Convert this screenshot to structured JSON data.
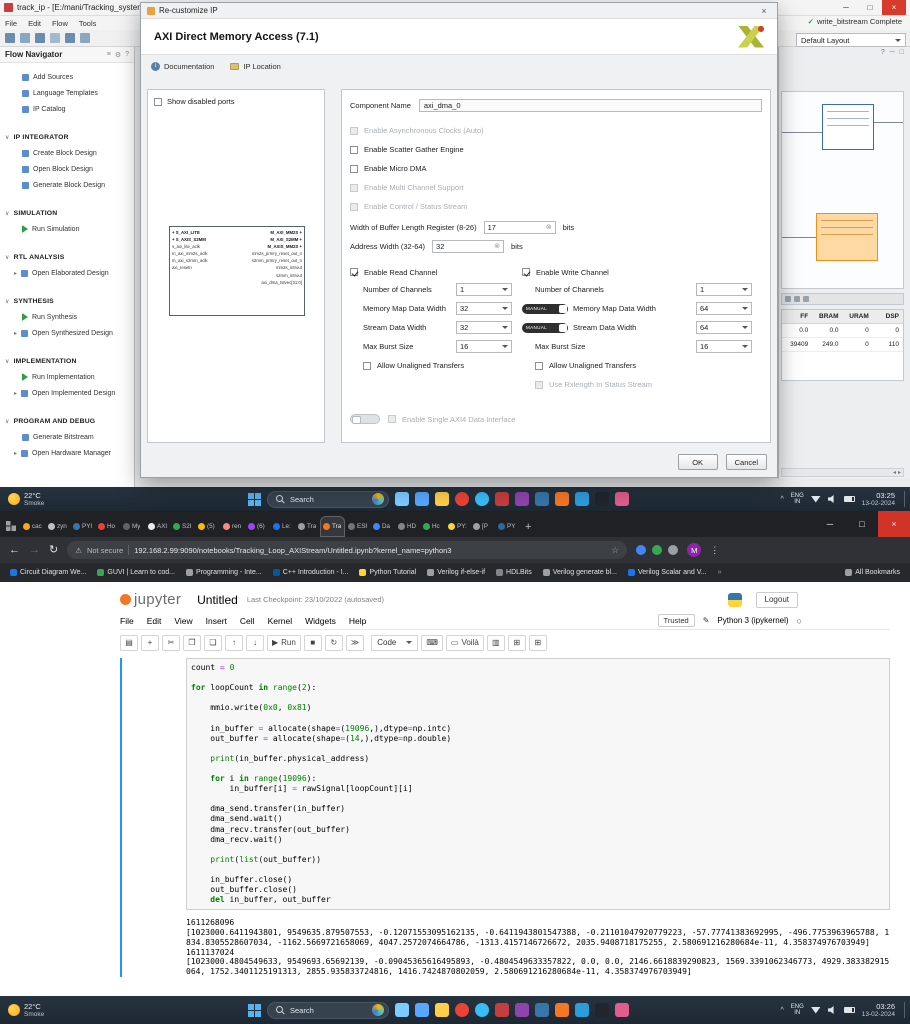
{
  "glyphs": {
    "min": "─",
    "max": "□",
    "close": "×",
    "chevron_down": "∨",
    "tri_right": "▸",
    "check": "✓",
    "reset": "⊗",
    "caret_up": "^",
    "back": "←",
    "forward": "→",
    "reload": "↻",
    "star": "☆",
    "menu_dots": "⋮",
    "plus": "+",
    "chevrons_right": "»",
    "question": "?",
    "info_i": "i",
    "kernel_circle": "○",
    "pencil": "✎",
    "warn": "!"
  },
  "vivado": {
    "titlebar": {
      "title": "track_ip - [E:/mani/Tracking_system_fo"
    },
    "menus": [
      "File",
      "Edit",
      "Flow",
      "Tools"
    ],
    "status_complete": "write_bitstream Complete",
    "layout_dropdown": "Default Layout",
    "flow_navigator": {
      "title": "Flow Navigator",
      "top_items": [
        {
          "label": "Add Sources"
        },
        {
          "label": "Language Templates"
        },
        {
          "label": "IP Catalog"
        }
      ],
      "sections": [
        {
          "label": "IP INTEGRATOR",
          "items": [
            {
              "label": "Create Block Design"
            },
            {
              "label": "Open Block Design"
            },
            {
              "label": "Generate Block Design"
            }
          ]
        },
        {
          "label": "SIMULATION",
          "items": [
            {
              "label": "Run Simulation",
              "run": true
            }
          ]
        },
        {
          "label": "RTL ANALYSIS",
          "items": [
            {
              "label": "Open Elaborated Design",
              "exp": true
            }
          ]
        },
        {
          "label": "SYNTHESIS",
          "items": [
            {
              "label": "Run Synthesis",
              "run": true
            },
            {
              "label": "Open Synthesized Design",
              "exp": true
            }
          ]
        },
        {
          "label": "IMPLEMENTATION",
          "items": [
            {
              "label": "Run Implementation",
              "run": true
            },
            {
              "label": "Open Implemented Design",
              "exp": true
            }
          ]
        },
        {
          "label": "PROGRAM AND DEBUG",
          "items": [
            {
              "label": "Generate Bitstream"
            },
            {
              "label": "Open Hardware Manager",
              "exp": true
            }
          ]
        }
      ]
    },
    "right_table": {
      "headers": [
        "FF",
        "BRAM",
        "URAM",
        "DSP"
      ],
      "rows": [
        [
          "0.0",
          "0.0",
          "0",
          "0"
        ],
        [
          "39409",
          "249.0",
          "0",
          "110"
        ]
      ]
    }
  },
  "dialog": {
    "title": "Re-customize IP",
    "heading": "AXI Direct Memory Access (7.1)",
    "doc_tab": "Documentation",
    "location_tab": "IP Location",
    "show_disabled_ports": "Show disabled ports",
    "block": {
      "left_interfaces": [
        "S_AXI_LITE",
        "S_AXIS_S2MM"
      ],
      "left_pins": [
        "s_axi_lite_aclk",
        "m_axi_mm2s_aclk",
        "m_axi_s2mm_aclk",
        "axi_resetn"
      ],
      "right_interfaces": [
        "M_AXI_MM2S",
        "M_AXI_S2MM",
        "M_AXIS_MM2S"
      ],
      "right_pins": [
        "mm2s_prmry_reset_out_n",
        "s2mm_prmry_reset_out_n",
        "mm2s_introut",
        "s2mm_introut",
        "axi_dma_tstvec[31:0]"
      ]
    },
    "component_name_label": "Component Name",
    "component_name_value": "axi_dma_0",
    "options": [
      {
        "label": "Enable Asynchronous Clocks (Auto)",
        "checked": false,
        "disabled": true
      },
      {
        "label": "Enable Scatter Gather Engine",
        "checked": false,
        "disabled": false
      },
      {
        "label": "Enable Micro DMA",
        "checked": false,
        "disabled": false
      },
      {
        "label": "Enable Multi Channel Support",
        "checked": false,
        "disabled": true
      },
      {
        "label": "Enable Control / Status Stream",
        "checked": false,
        "disabled": true
      }
    ],
    "buffer_length": {
      "label": "Width of Buffer Length Register (8-26)",
      "value": "17",
      "unit": "bits"
    },
    "address_width": {
      "label": "Address Width (32-64)",
      "value": "32",
      "unit": "bits"
    },
    "read_channel": {
      "title": "Enable Read Channel",
      "rows": [
        {
          "label": "Number of Channels",
          "value": "1",
          "manual": false
        },
        {
          "label": "Memory Map Data Width",
          "value": "32",
          "manual": false
        },
        {
          "label": "Stream Data Width",
          "value": "32",
          "manual": false
        },
        {
          "label": "Max Burst Size",
          "value": "16",
          "manual": false
        }
      ],
      "allow_unaligned": "Allow Unaligned Transfers"
    },
    "write_channel": {
      "title": "Enable Write Channel",
      "rows": [
        {
          "label": "Number of Channels",
          "value": "1",
          "manual": false
        },
        {
          "label": "Memory Map Data Width",
          "value": "64",
          "manual": true
        },
        {
          "label": "Stream Data Width",
          "value": "64",
          "manual": true
        },
        {
          "label": "Max Burst Size",
          "value": "16",
          "manual": false
        }
      ],
      "allow_unaligned": "Allow Unaligned Transfers",
      "use_rxlength": "Use Rxlength In Status Stream"
    },
    "manual_label": "MANUAL",
    "single_axi4": "Enable Single AXI4 Data Interface",
    "ok": "OK",
    "cancel": "Cancel"
  },
  "taskbar": {
    "temp": "22°C",
    "desc": "Smoke",
    "search": "Search",
    "lang1": "ENG",
    "lang2": "IN",
    "time_top": "03:25",
    "time_bottom": "03:26",
    "date": "13-02-2024",
    "apps": [
      {
        "name": "task-view-icon",
        "color": "#7ecbff"
      },
      {
        "name": "widgets-icon",
        "color": "#58a6ff"
      },
      {
        "name": "file-explorer-icon",
        "color": "#ffcf4a"
      },
      {
        "name": "chrome-icon",
        "color": "#ea4335",
        "round": true
      },
      {
        "name": "edge-icon",
        "color": "#38bdf8",
        "round": true
      },
      {
        "name": "vivado-icon",
        "color": "#c43e3e"
      },
      {
        "name": "vitis-icon",
        "color": "#8e44ad"
      },
      {
        "name": "python-icon",
        "color": "#3776ab"
      },
      {
        "name": "jupyter-icon",
        "color": "#f37726"
      },
      {
        "name": "vscode-icon",
        "color": "#2d9cdb"
      },
      {
        "name": "terminal-icon",
        "color": "#20262c"
      },
      {
        "name": "mail-icon",
        "color": "#e05d8e"
      }
    ]
  },
  "browser": {
    "active_tab_index": 12,
    "tabs": [
      {
        "l": "cac",
        "c": "#f5a623"
      },
      {
        "l": "zyn",
        "c": "#bdc1c6"
      },
      {
        "l": "PYI",
        "c": "#3776ab"
      },
      {
        "l": "Ho",
        "c": "#ea4335"
      },
      {
        "l": "My",
        "c": "#5f6368"
      },
      {
        "l": "AXI",
        "c": "#e8eaed"
      },
      {
        "l": "S2I",
        "c": "#34a853"
      },
      {
        "l": "(5)",
        "c": "#fbbc04"
      },
      {
        "l": "ren",
        "c": "#f28b82"
      },
      {
        "l": "(6)",
        "c": "#a142f4"
      },
      {
        "l": "Le:",
        "c": "#1a73e8"
      },
      {
        "l": "Tra",
        "c": "#9aa0a6"
      },
      {
        "l": "Tra",
        "c": "#f37726"
      },
      {
        "l": "ESF",
        "c": "#70757a"
      },
      {
        "l": "Da",
        "c": "#4285f4"
      },
      {
        "l": "HD",
        "c": "#80868b"
      },
      {
        "l": "Hc",
        "c": "#34a853"
      },
      {
        "l": "PY:",
        "c": "#ffd43b"
      },
      {
        "l": "[P",
        "c": "#9aa0a6"
      },
      {
        "l": "PY",
        "c": "#306998"
      }
    ],
    "security": "Not secure",
    "url": "192.168.2.99:9090/notebooks/Tracking_Loop_AXIStream/Untitled.ipynb?kernel_name=python3",
    "extensions": [
      {
        "name": "extension-blue-icon",
        "color": "#4285f4"
      },
      {
        "name": "extension-green-icon",
        "color": "#34a853"
      },
      {
        "name": "extension-gray-icon",
        "color": "#9aa0a6"
      }
    ],
    "avatar_letter": "M",
    "bookmarks": [
      {
        "label": "Circuit Diagram We...",
        "color": "#1a73e8"
      },
      {
        "label": "GUVI | Learn to cod...",
        "color": "#34a853"
      },
      {
        "label": "Programming - Inte...",
        "color": "#9aa0a6"
      },
      {
        "label": "C++ Introduction - I...",
        "color": "#00599c"
      },
      {
        "label": "Python Tutorial",
        "color": "#ffd43b"
      },
      {
        "label": "Verilog if-else-if",
        "color": "#9aa0a6"
      },
      {
        "label": "HDLBits",
        "color": "#80868b"
      },
      {
        "label": "Verilog generate bl...",
        "color": "#9aa0a6"
      },
      {
        "label": "Verilog Scalar and V...",
        "color": "#1a73e8"
      }
    ],
    "all_bookmarks": "All Bookmarks"
  },
  "jupyter": {
    "logo_text": "jupyter",
    "title": "Untitled",
    "checkpoint": "Last Checkpoint: 23/10/2022  (autosaved)",
    "logout": "Logout",
    "menus": [
      "File",
      "Edit",
      "View",
      "Insert",
      "Cell",
      "Kernel",
      "Widgets",
      "Help"
    ],
    "trusted": "Trusted",
    "kernel": "Python 3 (ipykernel)",
    "cell_type": "Code",
    "run_label": "Run",
    "voila": "Voilà",
    "toolbar_icons": [
      {
        "g": "▤",
        "n": "save-notebook-button"
      },
      {
        "g": "+",
        "n": "add-cell-button"
      },
      {
        "g": "✂",
        "n": "cut-cell-button"
      },
      {
        "g": "❐",
        "n": "copy-cell-button"
      },
      {
        "g": "❏",
        "n": "paste-cell-button"
      },
      {
        "g": "↑",
        "n": "move-cell-up-button"
      },
      {
        "g": "↓",
        "n": "move-cell-down-button"
      },
      {
        "g": "▶",
        "n": "run-button",
        "run": true
      },
      {
        "g": "■",
        "n": "stop-kernel-button"
      },
      {
        "g": "↻",
        "n": "restart-kernel-button"
      },
      {
        "g": "≫",
        "n": "restart-run-all-button"
      }
    ],
    "after_icons": [
      {
        "g": "⌨",
        "n": "keyboard-icon"
      },
      {
        "g": "▭",
        "n": "voila-button",
        "voila": true
      },
      {
        "g": "▥",
        "n": "chart-icon"
      },
      {
        "g": "⊞",
        "n": "grid-view-icon"
      },
      {
        "g": "⊞",
        "n": "table-view-icon"
      }
    ],
    "code_lines": [
      [
        [
          "p",
          "count "
        ],
        [
          "o",
          "="
        ],
        [
          "p",
          " "
        ],
        [
          "n",
          "0"
        ]
      ],
      [],
      [
        [
          "k",
          "for"
        ],
        [
          "p",
          " loopCount "
        ],
        [
          "k",
          "in"
        ],
        [
          "p",
          " "
        ],
        [
          "b",
          "range"
        ],
        [
          "p",
          "("
        ],
        [
          "n",
          "2"
        ],
        [
          "p",
          "):"
        ]
      ],
      [],
      [
        [
          "p",
          "    mmio.write("
        ],
        [
          "n",
          "0x0"
        ],
        [
          "p",
          ", "
        ],
        [
          "n",
          "0x81"
        ],
        [
          "p",
          ")"
        ]
      ],
      [],
      [
        [
          "p",
          "    in_buffer "
        ],
        [
          "o",
          "="
        ],
        [
          "p",
          " allocate(shape"
        ],
        [
          "o",
          "="
        ],
        [
          "p",
          "("
        ],
        [
          "n",
          "19096"
        ],
        [
          "p",
          ",),dtype"
        ],
        [
          "o",
          "="
        ],
        [
          "p",
          "np.intc)"
        ]
      ],
      [
        [
          "p",
          "    out_buffer "
        ],
        [
          "o",
          "="
        ],
        [
          "p",
          " allocate(shape"
        ],
        [
          "o",
          "="
        ],
        [
          "p",
          "("
        ],
        [
          "n",
          "14"
        ],
        [
          "p",
          ",),dtype"
        ],
        [
          "o",
          "="
        ],
        [
          "p",
          "np.double)"
        ]
      ],
      [],
      [
        [
          "p",
          "    "
        ],
        [
          "b",
          "print"
        ],
        [
          "p",
          "(in_buffer.physical_address)"
        ]
      ],
      [],
      [
        [
          "p",
          "    "
        ],
        [
          "k",
          "for"
        ],
        [
          "p",
          " i "
        ],
        [
          "k",
          "in"
        ],
        [
          "p",
          " "
        ],
        [
          "b",
          "range"
        ],
        [
          "p",
          "("
        ],
        [
          "n",
          "19096"
        ],
        [
          "p",
          "):"
        ]
      ],
      [
        [
          "p",
          "        in_buffer[i] "
        ],
        [
          "o",
          "="
        ],
        [
          "p",
          " rawSignal[loopCount][i]"
        ]
      ],
      [],
      [
        [
          "p",
          "    dma_send.transfer(in_buffer)"
        ]
      ],
      [
        [
          "p",
          "    dma_send.wait()"
        ]
      ],
      [
        [
          "p",
          "    dma_recv.transfer(out_buffer)"
        ]
      ],
      [
        [
          "p",
          "    dma_recv.wait()"
        ]
      ],
      [],
      [
        [
          "p",
          "    "
        ],
        [
          "b",
          "print"
        ],
        [
          "p",
          "("
        ],
        [
          "b",
          "list"
        ],
        [
          "p",
          "(out_buffer))"
        ]
      ],
      [],
      [
        [
          "p",
          "    in_buffer.close()"
        ]
      ],
      [
        [
          "p",
          "    out_buffer.close()"
        ]
      ],
      [
        [
          "p",
          "    "
        ],
        [
          "k",
          "del"
        ],
        [
          "p",
          " in_buffer, out_buffer"
        ]
      ]
    ],
    "output_lines": [
      "1611268096",
      "[1023000.6411943801, 9549635.879507553, -0.12071553095162135, -0.6411943801547388, -0.21101047920779223, -57.77741383692995, -496.7753963965788, 1834.8305528607034, -1162.5669721658069, 4047.2572074664786, -1313.4157146726672, 2035.9408718175255, 2.580691216280684e-11, 4.358374976703949]",
      "1611137024",
      "[1023000.4804549633, 9549693.65692139, -0.09045365616495893, -0.4804549633357822, 0.0, 0.0, 2146.6618839290823, 1569.3391062346773, 4929.383382915064, 1752.3401125191313, 2855.935833724816, 1416.7424870802059, 2.580691216280684e-11, 4.358374976703949]"
    ]
  }
}
